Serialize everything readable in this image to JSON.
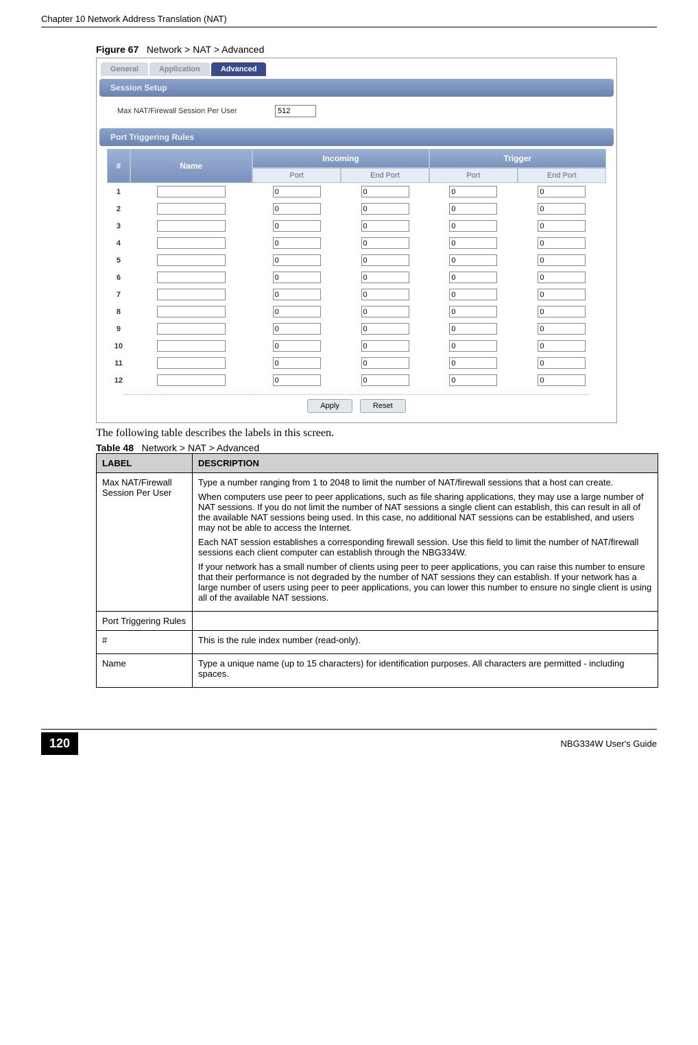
{
  "chapter_header": "Chapter 10 Network Address Translation (NAT)",
  "figure": {
    "label": "Figure 67",
    "caption": "Network > NAT > Advanced"
  },
  "screenshot": {
    "tabs": {
      "general": "General",
      "application": "Application",
      "advanced": "Advanced"
    },
    "session_setup": {
      "title": "Session Setup",
      "max_label": "Max NAT/Firewall Session Per User",
      "max_value": "512"
    },
    "port_triggering": {
      "title": "Port Triggering Rules",
      "headers": {
        "num": "#",
        "name": "Name",
        "incoming": "Incoming",
        "trigger": "Trigger",
        "port": "Port",
        "end_port": "End Port"
      },
      "rows": [
        {
          "n": "1",
          "name": "",
          "ip": "0",
          "iep": "0",
          "tp": "0",
          "tep": "0"
        },
        {
          "n": "2",
          "name": "",
          "ip": "0",
          "iep": "0",
          "tp": "0",
          "tep": "0"
        },
        {
          "n": "3",
          "name": "",
          "ip": "0",
          "iep": "0",
          "tp": "0",
          "tep": "0"
        },
        {
          "n": "4",
          "name": "",
          "ip": "0",
          "iep": "0",
          "tp": "0",
          "tep": "0"
        },
        {
          "n": "5",
          "name": "",
          "ip": "0",
          "iep": "0",
          "tp": "0",
          "tep": "0"
        },
        {
          "n": "6",
          "name": "",
          "ip": "0",
          "iep": "0",
          "tp": "0",
          "tep": "0"
        },
        {
          "n": "7",
          "name": "",
          "ip": "0",
          "iep": "0",
          "tp": "0",
          "tep": "0"
        },
        {
          "n": "8",
          "name": "",
          "ip": "0",
          "iep": "0",
          "tp": "0",
          "tep": "0"
        },
        {
          "n": "9",
          "name": "",
          "ip": "0",
          "iep": "0",
          "tp": "0",
          "tep": "0"
        },
        {
          "n": "10",
          "name": "",
          "ip": "0",
          "iep": "0",
          "tp": "0",
          "tep": "0"
        },
        {
          "n": "11",
          "name": "",
          "ip": "0",
          "iep": "0",
          "tp": "0",
          "tep": "0"
        },
        {
          "n": "12",
          "name": "",
          "ip": "0",
          "iep": "0",
          "tp": "0",
          "tep": "0"
        }
      ],
      "apply": "Apply",
      "reset": "Reset"
    }
  },
  "body_text": "The following table describes the labels in this screen.",
  "table": {
    "label": "Table 48",
    "caption": "Network > NAT > Advanced",
    "head_label": "LABEL",
    "head_desc": "DESCRIPTION",
    "rows": [
      {
        "label": "Max NAT/Firewall Session Per User",
        "desc": [
          "Type a number ranging from 1 to 2048 to limit the number of NAT/firewall sessions that a host can create.",
          "When computers use peer to peer applications, such as file sharing applications, they may use a large number of NAT sessions. If you do not limit the number of NAT sessions a single client can establish, this can result in all of the available NAT sessions being used. In this case, no additional NAT sessions can be established, and users may not be able to access the Internet.",
          "Each NAT session establishes a corresponding firewall session. Use this field to limit the number of NAT/firewall sessions each client computer can establish through the NBG334W.",
          "If your network has a small number of clients using peer to peer applications, you can raise this number to ensure that their performance is not degraded by the number of NAT sessions they can establish. If your network has a large number of users using peer to peer applications, you can lower this number to ensure no single client is using all of the available NAT sessions."
        ]
      },
      {
        "label": "Port Triggering Rules",
        "desc": [
          ""
        ]
      },
      {
        "label": "#",
        "desc": [
          "This is the rule index number (read-only)."
        ]
      },
      {
        "label": "Name",
        "desc": [
          "Type a unique name (up to 15 characters) for identification purposes. All characters are permitted - including spaces."
        ]
      }
    ]
  },
  "footer": {
    "page": "120",
    "guide": "NBG334W User's Guide"
  }
}
